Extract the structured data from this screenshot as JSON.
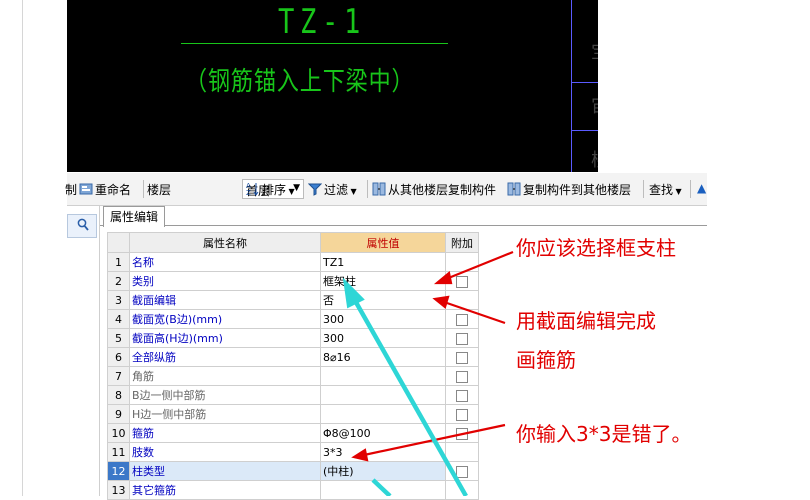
{
  "cad": {
    "title": "TZ-1",
    "subtitle": "（钢筋锚入上下梁中）",
    "side_glyphs": [
      "宝",
      "宙",
      "楼"
    ]
  },
  "toolbar": {
    "cut_label": "制",
    "rename": "重命名",
    "floor_label": "楼层",
    "floor_value": "首层",
    "sort": "排序",
    "filter": "过滤",
    "copy_from": "从其他楼层复制构件",
    "copy_to": "复制构件到其他楼层",
    "find": "查找"
  },
  "tab": {
    "label": "属性编辑"
  },
  "grid": {
    "headers": [
      "属性名称",
      "属性值",
      "附加"
    ],
    "rows": [
      {
        "n": "1",
        "name": "名称",
        "value": "TZ1",
        "grey": false,
        "cb": false
      },
      {
        "n": "2",
        "name": "类别",
        "value": "框架柱",
        "grey": false,
        "cb": true
      },
      {
        "n": "3",
        "name": "截面编辑",
        "value": "否",
        "grey": false,
        "cb": false
      },
      {
        "n": "4",
        "name": "截面宽(B边)(mm)",
        "value": "300",
        "grey": false,
        "cb": true
      },
      {
        "n": "5",
        "name": "截面高(H边)(mm)",
        "value": "300",
        "grey": false,
        "cb": true
      },
      {
        "n": "6",
        "name": "全部纵筋",
        "value": "8⌀16",
        "grey": false,
        "cb": true
      },
      {
        "n": "7",
        "name": "角筋",
        "value": "",
        "grey": true,
        "cb": true
      },
      {
        "n": "8",
        "name": "B边一侧中部筋",
        "value": "",
        "grey": true,
        "cb": true
      },
      {
        "n": "9",
        "name": "H边一侧中部筋",
        "value": "",
        "grey": true,
        "cb": true
      },
      {
        "n": "10",
        "name": "箍筋",
        "value": "Φ8@100",
        "grey": false,
        "cb": true
      },
      {
        "n": "11",
        "name": "肢数",
        "value": "3*3",
        "grey": false,
        "cb": false
      },
      {
        "n": "12",
        "name": "柱类型",
        "value": "(中柱)",
        "grey": false,
        "cb": true
      },
      {
        "n": "13",
        "name": "其它箍筋",
        "value": "",
        "grey": false,
        "cb": false
      }
    ]
  },
  "annotations": {
    "a1": "你应该选择框支柱",
    "a2_line1": "用截面编辑完成",
    "a2_line2": "画箍筋",
    "a3": "你输入3*3是错了。"
  },
  "colors": {
    "annotation": "#e10000",
    "arrow_cyan": "#2ed6d6",
    "cad_text": "#18c51a",
    "header_value_bg": "#f5d69a"
  }
}
